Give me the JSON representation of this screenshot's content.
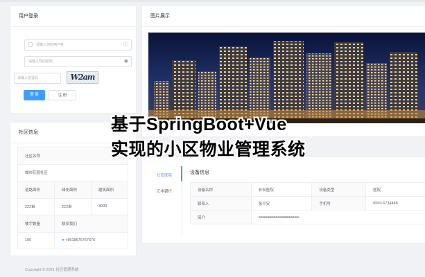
{
  "login": {
    "title": "用户登录",
    "username_placeholder": "请输入你的用户名",
    "password_placeholder": "请输入你的密码",
    "captcha_placeholder": "请输入验证码",
    "captcha_text": "W2am",
    "login_label": "登 录",
    "register_label": "注 册"
  },
  "community": {
    "title": "社区信息",
    "name_label": "社区名称",
    "name_value": "城市花园社区",
    "road_area_label": "道路面积",
    "green_area_label": "绿化面积",
    "building_area_label": "建筑面积",
    "road_area_value": "222亩",
    "green_area_value": "222亩",
    "building_area_value": "3000",
    "buildings_label": "楼宇数量",
    "contact_label": "联系我们",
    "buildings_value": "100",
    "contact_value": "+8618676767676"
  },
  "gallery": {
    "title": "图片展示"
  },
  "property": {
    "tabs": [
      "长安医院",
      "汇丰银行"
    ],
    "section_title": "设备信息",
    "rows": [
      [
        "设备名称",
        "长安医院",
        "设备类型",
        "医院"
      ],
      [
        "联系人",
        "张平安",
        "手机号",
        "0550-6734488"
      ],
      [
        "简介",
        "aaaaaaaaaaaaaaaaaaa",
        "",
        ""
      ]
    ]
  },
  "overlay": {
    "line1": "基于SpringBoot+Vue",
    "line2": "实现的小区物业管理系统"
  },
  "footer": {
    "copyright": "Copyright © 2021 社区管理系统"
  }
}
